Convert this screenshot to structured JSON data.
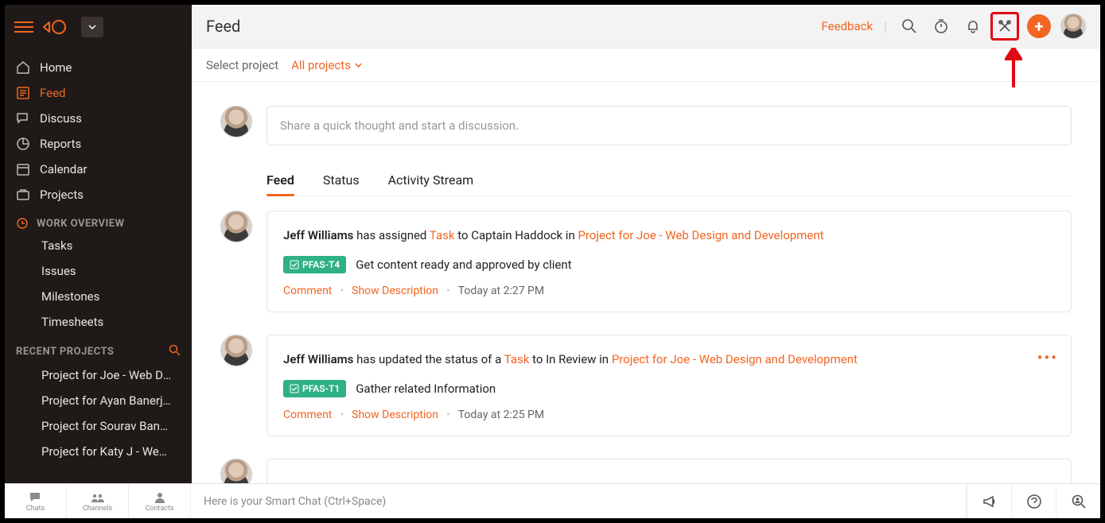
{
  "header": {
    "title": "Feed",
    "feedback": "Feedback"
  },
  "subheader": {
    "select_label": "Select project",
    "project_filter": "All projects"
  },
  "compose": {
    "placeholder": "Share a quick thought and start a discussion."
  },
  "tabs": {
    "feed": "Feed",
    "status": "Status",
    "activity": "Activity Stream"
  },
  "sidebar": {
    "nav": {
      "home": "Home",
      "feed": "Feed",
      "discuss": "Discuss",
      "reports": "Reports",
      "calendar": "Calendar",
      "projects": "Projects"
    },
    "work_overview": {
      "title": "WORK OVERVIEW",
      "tasks": "Tasks",
      "issues": "Issues",
      "milestones": "Milestones",
      "timesheets": "Timesheets"
    },
    "recent": {
      "title": "RECENT PROJECTS",
      "p0": "Project for Joe - Web Design and Development",
      "p1": "Project for Ayan Banerjee",
      "p2": "Project for Sourav Banerjee",
      "p3": "Project for Katy J - Website"
    }
  },
  "feed": {
    "item0": {
      "author": "Jeff Williams",
      "mid1": " has assigned ",
      "link1": "Task",
      "mid2": " to Captain Haddock in ",
      "project": "Project for Joe - Web Design and Development",
      "badge": "PFAS-T4",
      "task": "Get content ready and approved by client",
      "comment": "Comment",
      "show_desc": "Show Description",
      "time": "Today at 2:27 PM"
    },
    "item1": {
      "author": "Jeff Williams",
      "mid1": " has updated the status of a ",
      "link1": "Task",
      "mid2": " to In Review in ",
      "project": "Project for Joe - Web Design and Development",
      "badge": "PFAS-T1",
      "task": "Gather related Information",
      "comment": "Comment",
      "show_desc": "Show Description",
      "time": "Today at 2:25 PM"
    }
  },
  "bottombar": {
    "chats": "Chats",
    "channels": "Channels",
    "contacts": "Contacts",
    "smartchat": "Here is your Smart Chat (Ctrl+Space)"
  }
}
